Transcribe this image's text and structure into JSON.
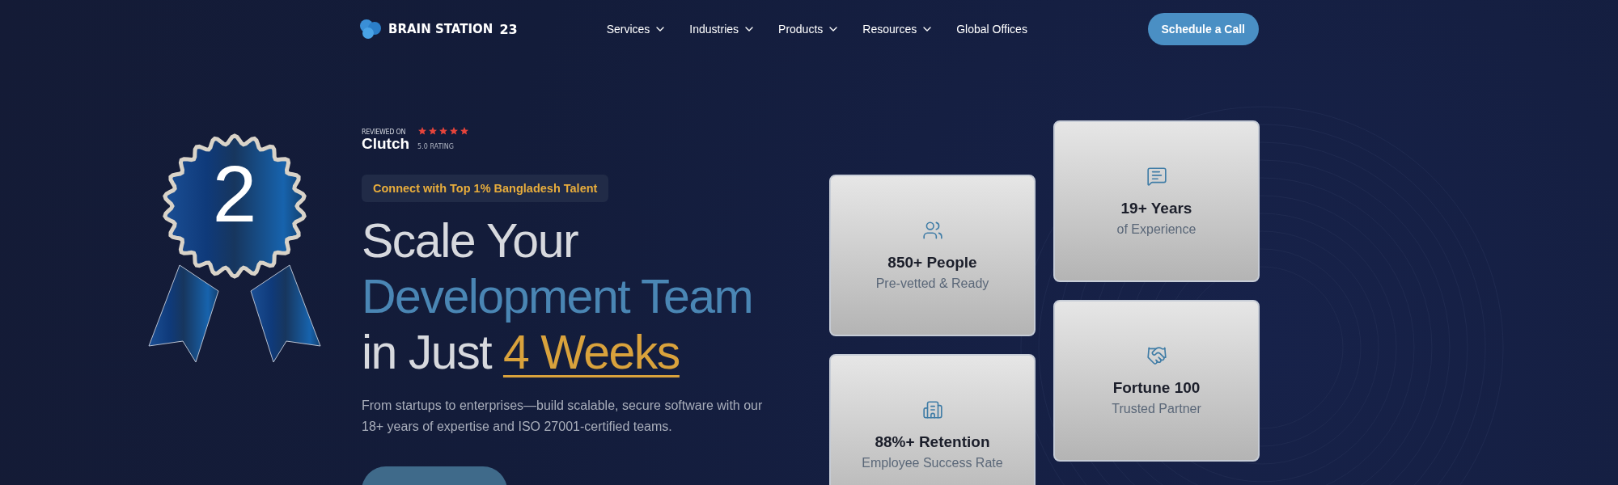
{
  "header": {
    "logo_text": "BRAIN STATION",
    "logo_number": "23",
    "nav": [
      {
        "label": "Services",
        "has_menu": true
      },
      {
        "label": "Industries",
        "has_menu": true
      },
      {
        "label": "Products",
        "has_menu": true
      },
      {
        "label": "Resources",
        "has_menu": true
      },
      {
        "label": "Global Offices",
        "has_menu": false
      }
    ],
    "cta": "Schedule a Call"
  },
  "badge": {
    "number": "2"
  },
  "review": {
    "reviewed_on": "REVIEWED ON",
    "platform": "Clutch",
    "stars": 5,
    "rating": "5.0 RATING"
  },
  "tagline": "Connect with Top 1% Bangladesh Talent",
  "headline": [
    [
      {
        "text": "Scale Your",
        "kind": "plain"
      }
    ],
    [
      {
        "text": "Development Team",
        "kind": "accent"
      }
    ],
    [
      {
        "text": "in Just ",
        "kind": "plain"
      },
      {
        "text": "4 Weeks",
        "kind": "highlight"
      }
    ]
  ],
  "description": "From startups to enterprises—build scalable, secure software with our 18+ years of expertise and ISO 27001-certified teams.",
  "stats": [
    {
      "kind": "people",
      "title": "850+ People",
      "subtitle": "Pre-vetted & Ready"
    },
    {
      "kind": "building",
      "title": "88%+ Retention",
      "subtitle": "Employee Success Rate"
    },
    {
      "kind": "chat",
      "title": "19+ Years",
      "subtitle": "of Experience"
    },
    {
      "kind": "handshake",
      "title": "Fortune 100",
      "subtitle": "Trusted Partner"
    }
  ]
}
